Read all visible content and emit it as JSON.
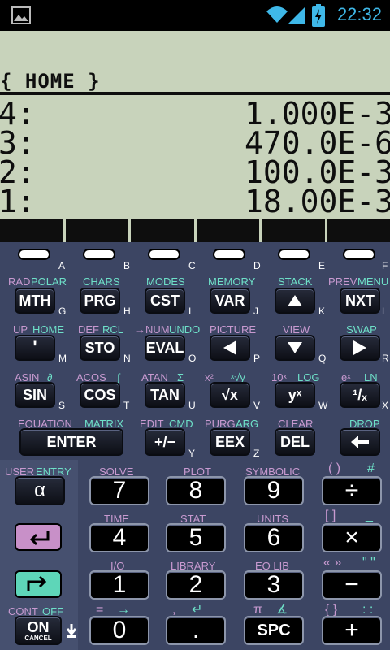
{
  "status": {
    "time": "22:32"
  },
  "display": {
    "title": "{ HOME }",
    "stack": [
      {
        "label": "4:",
        "value": "1.000E-3"
      },
      {
        "label": "3:",
        "value": "470.0E-6"
      },
      {
        "label": "2:",
        "value": "100.0E-3"
      },
      {
        "label": "1:",
        "value": "18.00E-3"
      }
    ]
  },
  "letters": [
    "A",
    "B",
    "C",
    "D",
    "E",
    "F",
    "G",
    "H",
    "I",
    "J",
    "K",
    "L",
    "M",
    "N",
    "O",
    "P",
    "Q",
    "R",
    "S",
    "T",
    "U",
    "V",
    "W",
    "X",
    "Y",
    "Z"
  ],
  "keys": {
    "mth": "MTH",
    "prg": "PRG",
    "cst": "CST",
    "var": "VAR",
    "nxt": "NXT",
    "tick": "'",
    "sto": "STO",
    "eval": "EVAL",
    "sin": "SIN",
    "cos": "COS",
    "tan": "TAN",
    "sqrt": "√x",
    "yx": "yˣ",
    "inv": "¹/ₓ",
    "enter": "ENTER",
    "neg": "+/−",
    "eex": "EEX",
    "del": "DEL",
    "alpha": "α",
    "seven": "7",
    "eight": "8",
    "nine": "9",
    "div": "÷",
    "four": "4",
    "five": "5",
    "six": "6",
    "mul": "×",
    "one": "1",
    "two": "2",
    "three": "3",
    "minus": "−",
    "on": "ON",
    "cancel": "CANCEL",
    "zero": "0",
    "dot": ".",
    "spc": "SPC",
    "plus": "+"
  },
  "labels": {
    "rad": "RAD",
    "polar": "POLAR",
    "chars": "CHARS",
    "modes": "MODES",
    "memory": "MEMORY",
    "stack": "STACK",
    "prev": "PREV",
    "menu": "MENU",
    "up": "UP",
    "home": "HOME",
    "def": "DEF",
    "rcl": "RCL",
    "num": "→NUM",
    "undo": "UNDO",
    "picture": "PICTURE",
    "view": "VIEW",
    "swap": "SWAP",
    "asin": "ASIN",
    "partial": "∂",
    "acos": "ACOS",
    "integral": "∫",
    "atan": "ATAN",
    "sigma": "Σ",
    "xsq": "x²",
    "xroot": "ˣ√y",
    "tenx": "10ˣ",
    "log": "LOG",
    "ex": "eˣ",
    "ln": "LN",
    "equation": "EQUATION",
    "matrix": "MATRIX",
    "edit": "EDIT",
    "cmd": "CMD",
    "purg": "PURG",
    "arg": "ARG",
    "clear": "CLEAR",
    "drop": "DROP",
    "user": "USER",
    "entry": "ENTRY",
    "solve": "SOLVE",
    "plot": "PLOT",
    "symbolic": "SYMBOLIC",
    "paren": "( )",
    "hash": "#",
    "time": "TIME",
    "stat": "STAT",
    "units": "UNITS",
    "bracket": "[ ]",
    "underscore": "_",
    "io": "I/O",
    "library": "LIBRARY",
    "eqlib": "EQ LIB",
    "guill": "« »",
    "quote": "\" \"",
    "cont": "CONT",
    "off": "OFF",
    "eq": "=",
    "arrow": "→",
    "comma": ",",
    "ret": "↵",
    "pi": "π",
    "angle": "∡",
    "brace": "{ }",
    "colons": ": :"
  }
}
